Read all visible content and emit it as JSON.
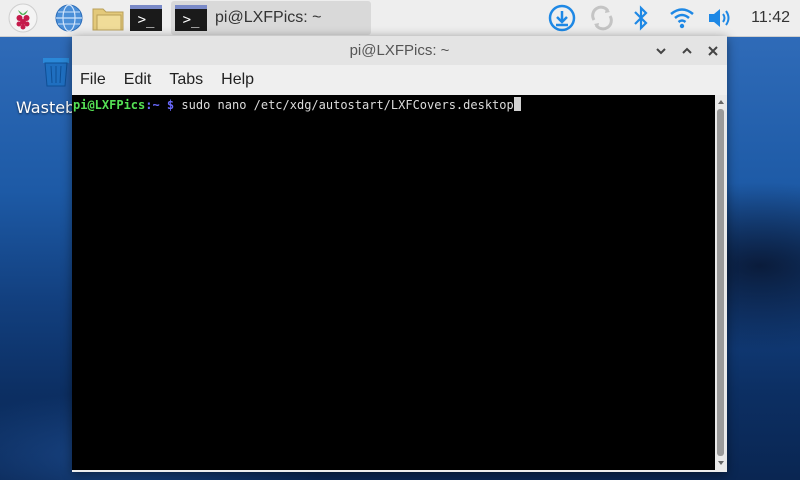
{
  "taskbar": {
    "task_title": "pi@LXFPics: ~",
    "clock": "11:42",
    "icons": [
      "raspberry-menu-icon",
      "web-browser-icon",
      "file-manager-icon",
      "terminal-icon",
      "download-icon",
      "sync-icon",
      "bluetooth-icon",
      "wifi-icon",
      "volume-icon"
    ]
  },
  "desktop": {
    "trash_label": "Wastebasket"
  },
  "window": {
    "title": "pi@LXFPics: ~",
    "menu": [
      "File",
      "Edit",
      "Tabs",
      "Help"
    ]
  },
  "terminal": {
    "user_host": "pi@LXFPics",
    "path": ":~",
    "prompt": " $ ",
    "command": "sudo nano /etc/xdg/autostart/LXFCovers.desktop"
  },
  "colors": {
    "prompt_user": "#55e055",
    "prompt_symbol": "#6a6aff",
    "taskbar_accent": "#1e88e5"
  }
}
